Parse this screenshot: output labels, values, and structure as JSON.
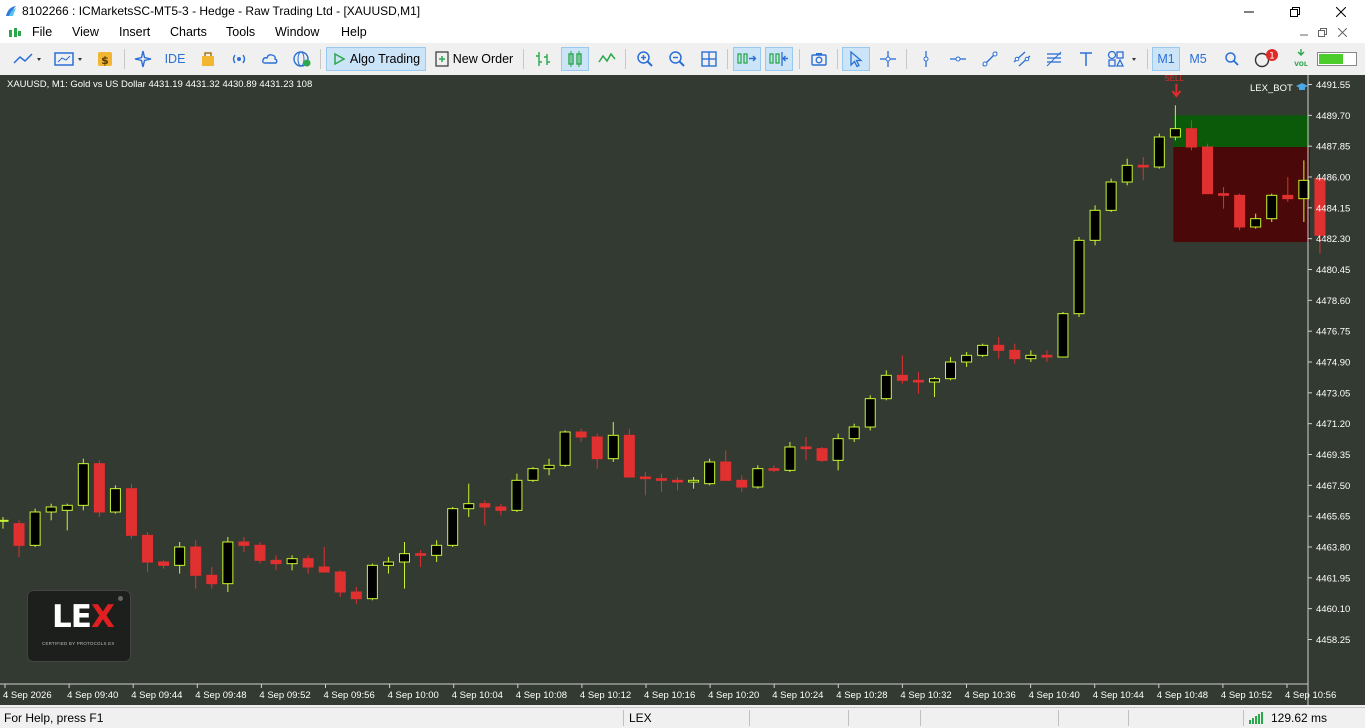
{
  "window": {
    "title": "8102266 : ICMarketsSC-MT5-3 - Hedge - Raw Trading Ltd - [XAUUSD,M1]"
  },
  "menu": [
    "File",
    "View",
    "Insert",
    "Charts",
    "Tools",
    "Window",
    "Help"
  ],
  "toolbar": {
    "ide_label": "IDE",
    "algo_trading_label": "Algo Trading",
    "new_order_label": "New Order",
    "m1_label": "M1",
    "m5_label": "M5",
    "notification_count": "1",
    "vol_label": "VOL"
  },
  "chart": {
    "info": "XAUUSD, M1:  Gold vs US Dollar  4431.19 4431.32 4430.89 4431.23  108",
    "ea_label": "LEX_BOT",
    "sell_label": "SELL",
    "logo_text_lex": "LE",
    "logo_text_x": "X",
    "logo_caption": "CERTIFIED BY PROTOCOLS EX",
    "colors": {
      "background": "#333a31",
      "bull": "#c8f532",
      "bear": "#e03030",
      "volume": "#e03030",
      "tp_zone": "#0a5a0a",
      "sl_zone": "#4a0808"
    }
  },
  "chart_data": {
    "type": "candlestick",
    "symbol": "XAUUSD",
    "timeframe": "M1",
    "price_axis": [
      "4491.55",
      "4489.70",
      "4487.85",
      "4486.00",
      "4484.15",
      "4482.30",
      "4480.45",
      "4478.60",
      "4476.75",
      "4474.90",
      "4473.05",
      "4471.20",
      "4469.35",
      "4467.50",
      "4465.65",
      "4463.80",
      "4461.95",
      "4460.10",
      "4458.25"
    ],
    "time_axis": [
      "4 Sep 2026",
      "4 Sep 09:40",
      "4 Sep 09:44",
      "4 Sep 09:48",
      "4 Sep 09:52",
      "4 Sep 09:56",
      "4 Sep 10:00",
      "4 Sep 10:04",
      "4 Sep 10:08",
      "4 Sep 10:12",
      "4 Sep 10:16",
      "4 Sep 10:20",
      "4 Sep 10:24",
      "4 Sep 10:28",
      "4 Sep 10:32",
      "4 Sep 10:36",
      "4 Sep 10:40",
      "4 Sep 10:44",
      "4 Sep 10:48",
      "4 Sep 10:52",
      "4 Sep 10:56"
    ],
    "ylim": [
      4457.2,
      4492.0
    ],
    "candles": [
      {
        "o": 4465.4,
        "h": 4465.6,
        "l": 4464.9,
        "c": 4465.4
      },
      {
        "o": 4465.2,
        "h": 4465.4,
        "l": 4463.2,
        "c": 4463.9
      },
      {
        "o": 4463.9,
        "h": 4466.1,
        "l": 4463.8,
        "c": 4465.9
      },
      {
        "o": 4465.9,
        "h": 4466.4,
        "l": 4465.4,
        "c": 4466.2
      },
      {
        "o": 4466.0,
        "h": 4466.4,
        "l": 4464.8,
        "c": 4466.3
      },
      {
        "o": 4466.3,
        "h": 4469.1,
        "l": 4466.0,
        "c": 4468.8
      },
      {
        "o": 4468.8,
        "h": 4469.0,
        "l": 4465.6,
        "c": 4465.9
      },
      {
        "o": 4465.9,
        "h": 4467.5,
        "l": 4465.8,
        "c": 4467.3
      },
      {
        "o": 4467.3,
        "h": 4467.6,
        "l": 4464.3,
        "c": 4464.5
      },
      {
        "o": 4464.5,
        "h": 4464.7,
        "l": 4462.3,
        "c": 4462.9
      },
      {
        "o": 4462.9,
        "h": 4463.0,
        "l": 4462.5,
        "c": 4462.7
      },
      {
        "o": 4462.7,
        "h": 4464.1,
        "l": 4462.2,
        "c": 4463.8
      },
      {
        "o": 4463.8,
        "h": 4464.2,
        "l": 4461.3,
        "c": 4462.1
      },
      {
        "o": 4462.1,
        "h": 4462.6,
        "l": 4461.3,
        "c": 4461.6
      },
      {
        "o": 4461.6,
        "h": 4464.4,
        "l": 4461.1,
        "c": 4464.1
      },
      {
        "o": 4464.1,
        "h": 4464.4,
        "l": 4463.5,
        "c": 4463.9
      },
      {
        "o": 4463.9,
        "h": 4464.1,
        "l": 4462.8,
        "c": 4463.0
      },
      {
        "o": 4463.0,
        "h": 4463.3,
        "l": 4462.4,
        "c": 4462.8
      },
      {
        "o": 4462.8,
        "h": 4463.3,
        "l": 4462.4,
        "c": 4463.1
      },
      {
        "o": 4463.1,
        "h": 4463.3,
        "l": 4462.2,
        "c": 4462.6
      },
      {
        "o": 4462.6,
        "h": 4463.8,
        "l": 4462.4,
        "c": 4462.3
      },
      {
        "o": 4462.3,
        "h": 4462.4,
        "l": 4460.8,
        "c": 4461.1
      },
      {
        "o": 4461.1,
        "h": 4461.4,
        "l": 4460.4,
        "c": 4460.7
      },
      {
        "o": 4460.7,
        "h": 4462.8,
        "l": 4460.6,
        "c": 4462.7
      },
      {
        "o": 4462.7,
        "h": 4463.2,
        "l": 4462.2,
        "c": 4462.9
      },
      {
        "o": 4462.9,
        "h": 4464.1,
        "l": 4461.3,
        "c": 4463.4
      },
      {
        "o": 4463.4,
        "h": 4463.6,
        "l": 4462.6,
        "c": 4463.3
      },
      {
        "o": 4463.3,
        "h": 4464.2,
        "l": 4462.9,
        "c": 4463.9
      },
      {
        "o": 4463.9,
        "h": 4466.2,
        "l": 4463.8,
        "c": 4466.1
      },
      {
        "o": 4466.1,
        "h": 4467.6,
        "l": 4465.6,
        "c": 4466.4
      },
      {
        "o": 4466.4,
        "h": 4466.6,
        "l": 4465.1,
        "c": 4466.2
      },
      {
        "o": 4466.2,
        "h": 4466.4,
        "l": 4465.7,
        "c": 4466.0
      },
      {
        "o": 4466.0,
        "h": 4468.2,
        "l": 4465.9,
        "c": 4467.8
      },
      {
        "o": 4467.8,
        "h": 4468.6,
        "l": 4467.7,
        "c": 4468.5
      },
      {
        "o": 4468.5,
        "h": 4469.1,
        "l": 4468.1,
        "c": 4468.7
      },
      {
        "o": 4468.7,
        "h": 4470.8,
        "l": 4468.6,
        "c": 4470.7
      },
      {
        "o": 4470.7,
        "h": 4470.9,
        "l": 4470.1,
        "c": 4470.4
      },
      {
        "o": 4470.4,
        "h": 4470.6,
        "l": 4468.5,
        "c": 4469.1
      },
      {
        "o": 4469.1,
        "h": 4471.3,
        "l": 4468.9,
        "c": 4470.5
      },
      {
        "o": 4470.5,
        "h": 4470.9,
        "l": 4468.0,
        "c": 4468.0
      },
      {
        "o": 4468.0,
        "h": 4468.3,
        "l": 4466.9,
        "c": 4467.9
      },
      {
        "o": 4467.9,
        "h": 4468.2,
        "l": 4467.1,
        "c": 4467.8
      },
      {
        "o": 4467.8,
        "h": 4468.0,
        "l": 4467.2,
        "c": 4467.7
      },
      {
        "o": 4467.7,
        "h": 4468.0,
        "l": 4467.3,
        "c": 4467.8
      },
      {
        "o": 4467.6,
        "h": 4469.1,
        "l": 4467.5,
        "c": 4468.9
      },
      {
        "o": 4468.9,
        "h": 4469.6,
        "l": 4467.8,
        "c": 4467.8
      },
      {
        "o": 4467.8,
        "h": 4468.1,
        "l": 4467.1,
        "c": 4467.4
      },
      {
        "o": 4467.4,
        "h": 4468.7,
        "l": 4467.3,
        "c": 4468.5
      },
      {
        "o": 4468.5,
        "h": 4468.7,
        "l": 4468.3,
        "c": 4468.4
      },
      {
        "o": 4468.4,
        "h": 4470.1,
        "l": 4468.3,
        "c": 4469.8
      },
      {
        "o": 4469.8,
        "h": 4470.4,
        "l": 4469.0,
        "c": 4469.7
      },
      {
        "o": 4469.7,
        "h": 4469.8,
        "l": 4468.9,
        "c": 4469.0
      },
      {
        "o": 4469.0,
        "h": 4470.6,
        "l": 4468.4,
        "c": 4470.3
      },
      {
        "o": 4470.3,
        "h": 4471.2,
        "l": 4470.1,
        "c": 4471.0
      },
      {
        "o": 4471.0,
        "h": 4472.9,
        "l": 4470.8,
        "c": 4472.7
      },
      {
        "o": 4472.7,
        "h": 4474.4,
        "l": 4472.6,
        "c": 4474.1
      },
      {
        "o": 4474.1,
        "h": 4475.3,
        "l": 4473.6,
        "c": 4473.8
      },
      {
        "o": 4473.8,
        "h": 4474.3,
        "l": 4473.0,
        "c": 4473.7
      },
      {
        "o": 4473.7,
        "h": 4474.0,
        "l": 4472.8,
        "c": 4473.9
      },
      {
        "o": 4473.9,
        "h": 4475.2,
        "l": 4473.8,
        "c": 4474.9
      },
      {
        "o": 4474.9,
        "h": 4475.5,
        "l": 4474.6,
        "c": 4475.3
      },
      {
        "o": 4475.3,
        "h": 4476.0,
        "l": 4475.2,
        "c": 4475.9
      },
      {
        "o": 4475.9,
        "h": 4476.4,
        "l": 4475.1,
        "c": 4475.6
      },
      {
        "o": 4475.6,
        "h": 4476.0,
        "l": 4474.8,
        "c": 4475.1
      },
      {
        "o": 4475.1,
        "h": 4475.6,
        "l": 4474.9,
        "c": 4475.3
      },
      {
        "o": 4475.3,
        "h": 4475.6,
        "l": 4474.9,
        "c": 4475.2
      },
      {
        "o": 4475.2,
        "h": 4477.9,
        "l": 4475.2,
        "c": 4477.8
      },
      {
        "o": 4477.8,
        "h": 4482.4,
        "l": 4477.6,
        "c": 4482.2
      },
      {
        "o": 4482.2,
        "h": 4484.3,
        "l": 4481.9,
        "c": 4484.0
      },
      {
        "o": 4484.0,
        "h": 4485.9,
        "l": 4483.9,
        "c": 4485.7
      },
      {
        "o": 4485.7,
        "h": 4487.1,
        "l": 4485.5,
        "c": 4486.7
      },
      {
        "o": 4486.7,
        "h": 4487.2,
        "l": 4485.8,
        "c": 4486.6
      },
      {
        "o": 4486.6,
        "h": 4488.6,
        "l": 4486.5,
        "c": 4488.4
      },
      {
        "o": 4488.4,
        "h": 4490.3,
        "l": 4488.2,
        "c": 4488.9
      },
      {
        "o": 4488.9,
        "h": 4489.4,
        "l": 4487.6,
        "c": 4487.8
      },
      {
        "o": 4487.8,
        "h": 4488.0,
        "l": 4485.1,
        "c": 4485.0
      },
      {
        "o": 4485.0,
        "h": 4485.4,
        "l": 4484.1,
        "c": 4484.9
      },
      {
        "o": 4484.9,
        "h": 4485.0,
        "l": 4482.8,
        "c": 4483.0
      },
      {
        "o": 4483.0,
        "h": 4483.8,
        "l": 4482.9,
        "c": 4483.5
      },
      {
        "o": 4483.5,
        "h": 4485.0,
        "l": 4483.3,
        "c": 4484.9
      },
      {
        "o": 4484.9,
        "h": 4486.0,
        "l": 4484.5,
        "c": 4484.7
      },
      {
        "o": 4484.7,
        "h": 4487.0,
        "l": 4483.3,
        "c": 4485.8
      },
      {
        "o": 4485.9,
        "h": 4486.0,
        "l": 4481.4,
        "c": 4482.5
      }
    ],
    "volumes": [
      0,
      0,
      0,
      0,
      0,
      0,
      0,
      0,
      0,
      0,
      0,
      0,
      0,
      0,
      0,
      0,
      0,
      0,
      0,
      0,
      0,
      0,
      0,
      0,
      0,
      0,
      0,
      0,
      0,
      0,
      0,
      0,
      0,
      0,
      0,
      0,
      0,
      0,
      0,
      0,
      0,
      0,
      0,
      0,
      0,
      0,
      0,
      0,
      0,
      0,
      0,
      0,
      0,
      0,
      0,
      0,
      0,
      0,
      0,
      0,
      0,
      0,
      0,
      0,
      0,
      0,
      0,
      0,
      0,
      0,
      0,
      0,
      0,
      0,
      0,
      0,
      0,
      0,
      0,
      0,
      0,
      0,
      0
    ],
    "trade": {
      "type": "sell",
      "label": "SELL",
      "entry": 4489.0,
      "take_profit": 4487.8,
      "stop_loss": 4482.1,
      "tp_top": 4489.7
    }
  },
  "status": {
    "help": "For Help, press F1",
    "profile": "LEX",
    "ping": "129.62 ms"
  }
}
